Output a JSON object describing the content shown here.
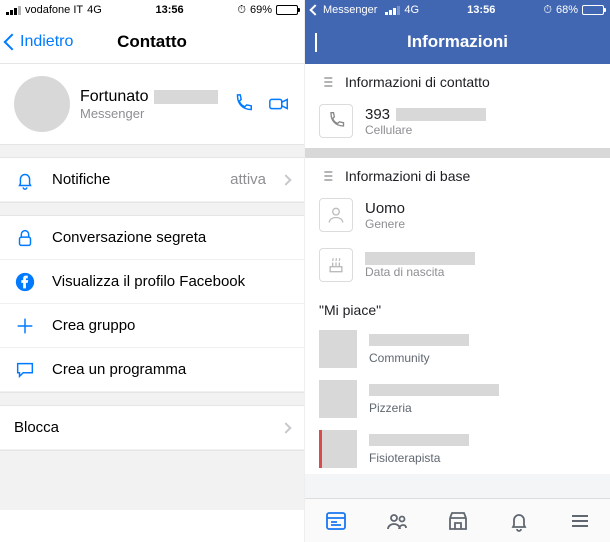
{
  "left": {
    "status": {
      "carrier": "vodafone IT",
      "net": "4G",
      "time": "13:56",
      "battery_pct": "69%"
    },
    "nav": {
      "back": "Indietro",
      "title": "Contatto"
    },
    "profile": {
      "name": "Fortunato",
      "sub": "Messenger"
    },
    "rows": {
      "notify": {
        "label": "Notifiche",
        "status": "attiva"
      },
      "secret": {
        "label": "Conversazione segreta"
      },
      "fbprofile": {
        "label": "Visualizza il profilo Facebook"
      },
      "newgroup": {
        "label": "Crea gruppo"
      },
      "program": {
        "label": "Crea un programma"
      },
      "block": {
        "label": "Blocca"
      }
    }
  },
  "right": {
    "status": {
      "app": "Messenger",
      "net": "4G",
      "time": "13:56",
      "battery_pct": "68%"
    },
    "nav": {
      "title": "Informazioni"
    },
    "contact_hdr": "Informazioni di contatto",
    "phone": {
      "value": "393",
      "label": "Cellulare"
    },
    "basic_hdr": "Informazioni di base",
    "gender": {
      "value": "Uomo",
      "label": "Genere"
    },
    "dob": {
      "label": "Data di nascita"
    },
    "likes_hdr": "\"Mi piace\"",
    "likes": [
      {
        "cat": "Community"
      },
      {
        "cat": "Pizzeria"
      },
      {
        "cat": "Fisioterapista"
      }
    ]
  }
}
